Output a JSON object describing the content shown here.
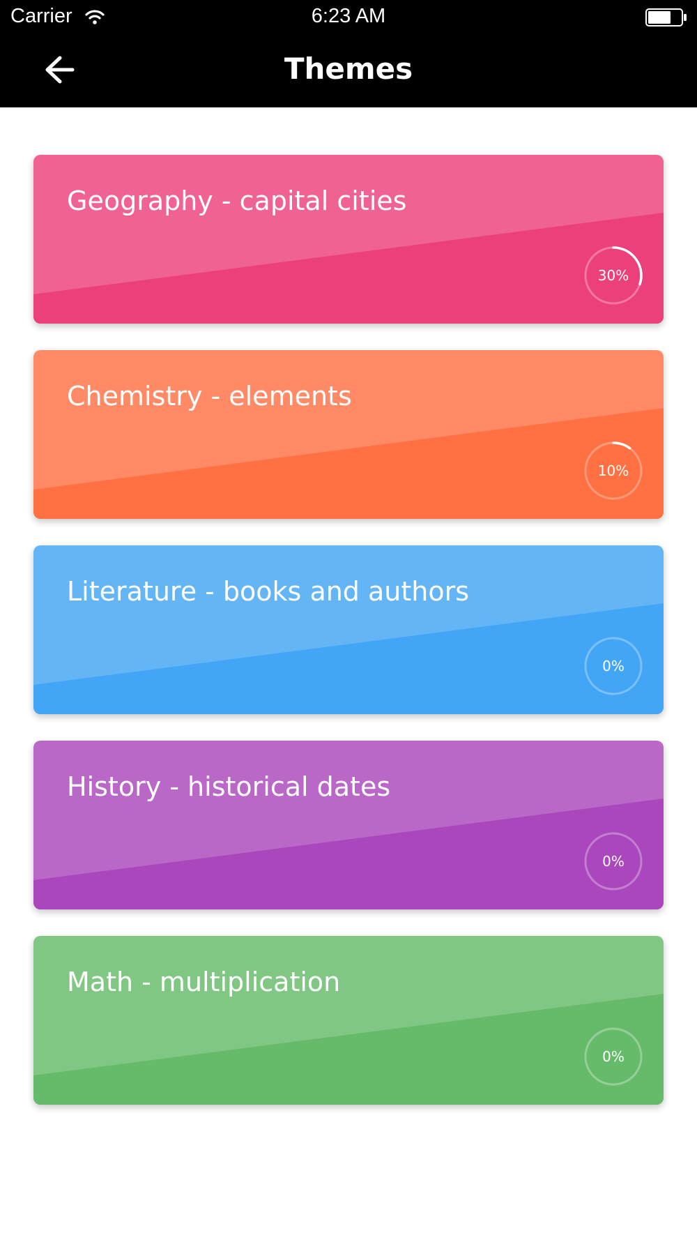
{
  "status_bar": {
    "carrier": "Carrier",
    "time": "6:23 AM"
  },
  "header": {
    "title": "Themes",
    "back_icon": "arrow-left-icon"
  },
  "themes": [
    {
      "title": "Geography - capital cities",
      "progress": 30,
      "progress_label": "30%",
      "color_light": "#F06292",
      "color_dark": "#EC407A"
    },
    {
      "title": "Chemistry - elements",
      "progress": 10,
      "progress_label": "10%",
      "color_light": "#FF8A65",
      "color_dark": "#FF7043"
    },
    {
      "title": "Literature - books and authors",
      "progress": 0,
      "progress_label": "0%",
      "color_light": "#64B5F6",
      "color_dark": "#42A5F5"
    },
    {
      "title": "History - historical dates",
      "progress": 0,
      "progress_label": "0%",
      "color_light": "#BA68C8",
      "color_dark": "#AB47BC"
    },
    {
      "title": "Math - multiplication",
      "progress": 0,
      "progress_label": "0%",
      "color_light": "#81C784",
      "color_dark": "#66BB6A"
    }
  ]
}
